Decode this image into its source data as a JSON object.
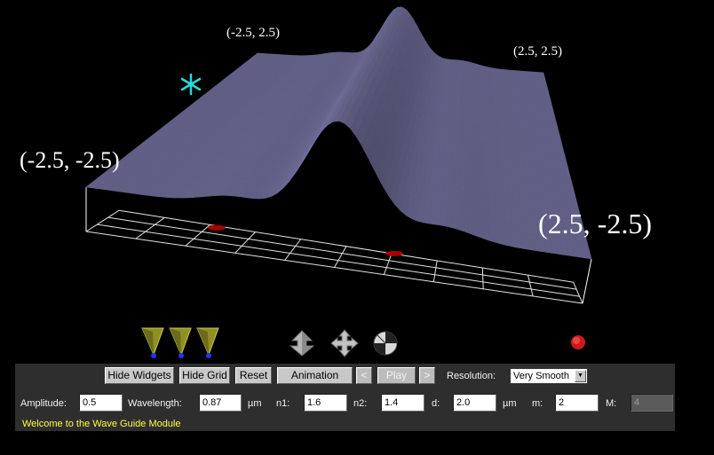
{
  "viewport": {
    "corners": {
      "top_left": "(-2.5, 2.5)",
      "top_right": "(2.5, 2.5)",
      "bottom_left": "(-2.5, -2.5)",
      "bottom_right": "(2.5, -2.5)"
    },
    "colors": {
      "surface": "#7c7aaa",
      "grid": "#ffffff",
      "marker": "#aa0000",
      "star": "#22dddd"
    }
  },
  "widgets": [
    {
      "name": "source-cone-icon-1"
    },
    {
      "name": "source-cone-icon-2"
    },
    {
      "name": "source-cone-icon-3"
    },
    {
      "name": "move-vertical-icon"
    },
    {
      "name": "move-cross-icon"
    },
    {
      "name": "rotate-ball-icon"
    },
    {
      "name": "record-indicator-icon"
    }
  ],
  "toolbar": {
    "hide_widgets": "Hide Widgets",
    "hide_grid": "Hide Grid",
    "reset": "Reset",
    "animation": "Animation",
    "prev": "<",
    "play": "Play",
    "next": ">",
    "resolution_label": "Resolution:",
    "resolution_value": "Very Smooth"
  },
  "params": {
    "amplitude_label": "Amplitude:",
    "amplitude": "0.5",
    "wavelength_label": "Wavelength:",
    "wavelength": "0.87",
    "wavelength_unit": "µm",
    "n1_label": "n1:",
    "n1": "1.6",
    "n2_label": "n2:",
    "n2": "1.4",
    "d_label": "d:",
    "d": "2.0",
    "d_unit": "µm",
    "m_label": "m:",
    "m": "2",
    "M_label": "M:",
    "M": "4"
  },
  "status": "Welcome to the Wave Guide Module"
}
